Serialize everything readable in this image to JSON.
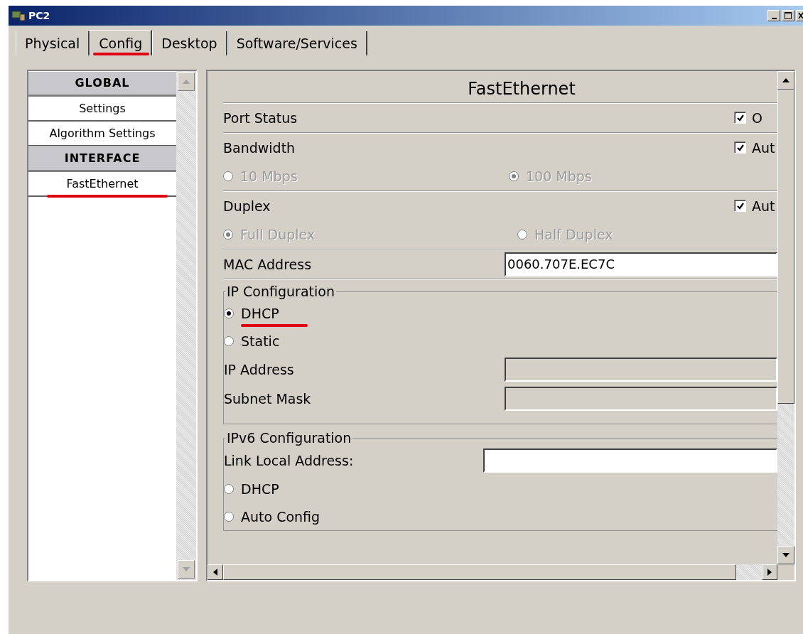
{
  "window": {
    "title": "PC2"
  },
  "tabs": [
    {
      "label": "Physical",
      "selected": false,
      "annotated": false
    },
    {
      "label": "Config",
      "selected": true,
      "annotated": true
    },
    {
      "label": "Desktop",
      "selected": false,
      "annotated": false
    },
    {
      "label": "Software/Services",
      "selected": false,
      "annotated": false
    }
  ],
  "sidebar": {
    "items": [
      {
        "kind": "header",
        "label": "GLOBAL",
        "annotated": false
      },
      {
        "kind": "item",
        "label": "Settings",
        "annotated": false
      },
      {
        "kind": "item",
        "label": "Algorithm Settings",
        "annotated": false
      },
      {
        "kind": "header",
        "label": "INTERFACE",
        "annotated": false
      },
      {
        "kind": "item",
        "label": "FastEthernet",
        "annotated": true
      }
    ]
  },
  "panel": {
    "heading": "FastEthernet",
    "port_status": {
      "label": "Port Status",
      "checkbox": {
        "label": "O",
        "checked": true
      }
    },
    "bandwidth": {
      "label": "Bandwidth",
      "checkbox": {
        "label": "Aut",
        "checked": true
      },
      "options": [
        {
          "label": "10 Mbps",
          "selected": false,
          "disabled": true
        },
        {
          "label": "100 Mbps",
          "selected": true,
          "disabled": true
        }
      ]
    },
    "duplex": {
      "label": "Duplex",
      "checkbox": {
        "label": "Aut",
        "checked": true
      },
      "options": [
        {
          "label": "Full Duplex",
          "selected": true,
          "disabled": true
        },
        {
          "label": "Half Duplex",
          "selected": false,
          "disabled": true
        }
      ]
    },
    "mac_address": {
      "label": "MAC Address",
      "value": "0060.707E.EC7C"
    },
    "ip_configuration": {
      "legend": "IP Configuration",
      "options": [
        {
          "label": "DHCP",
          "selected": true,
          "annotated": true
        },
        {
          "label": "Static",
          "selected": false,
          "annotated": false
        }
      ],
      "fields": [
        {
          "label": "IP Address"
        },
        {
          "label": "Subnet Mask"
        }
      ]
    },
    "ipv6_configuration": {
      "legend": "IPv6 Configuration",
      "link_local": {
        "label": "Link Local Address:"
      },
      "options": [
        {
          "label": "DHCP",
          "selected": false,
          "annotated": false
        },
        {
          "label": "Auto Config",
          "selected": false,
          "annotated": false
        }
      ]
    }
  }
}
